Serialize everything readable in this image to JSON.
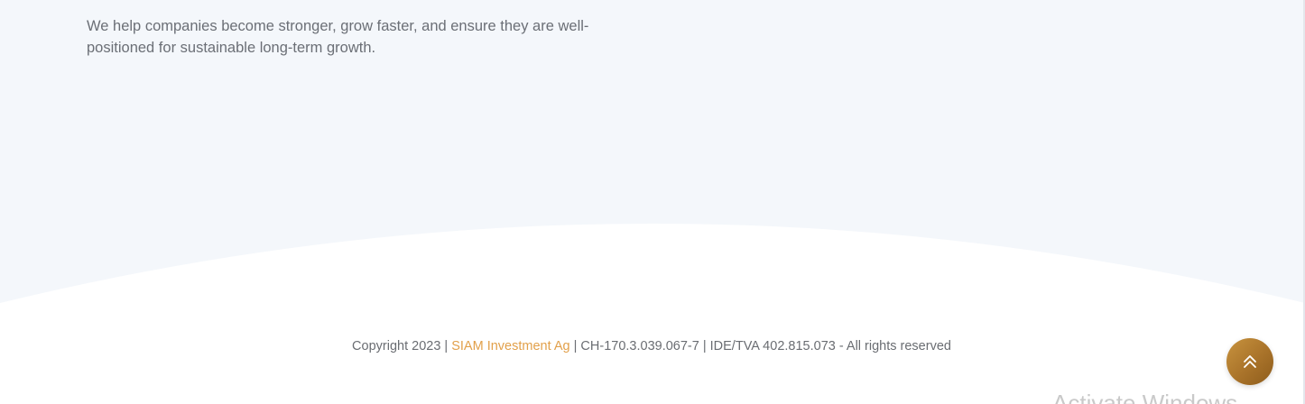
{
  "section": {
    "intro_text": "We help companies become stronger, grow faster, and ensure they are well-positioned for sustainable long-term growth."
  },
  "footer": {
    "prefix": "Copyright 2023 | ",
    "company_link": "SIAM Investment Ag",
    "suffix": " | CH-170.3.039.067-7 | IDE/TVA 402.815.073 - All rights reserved"
  },
  "scroll_top": {
    "icon": "double-chevron-up-icon"
  },
  "watermark": {
    "text": "Activate Windows"
  },
  "colors": {
    "section_background": "#f4f7fb",
    "footer_background": "#ffffff",
    "accent": "#e2a04a",
    "button_gold": "#b07a30",
    "body_text": "#6b6f76"
  }
}
